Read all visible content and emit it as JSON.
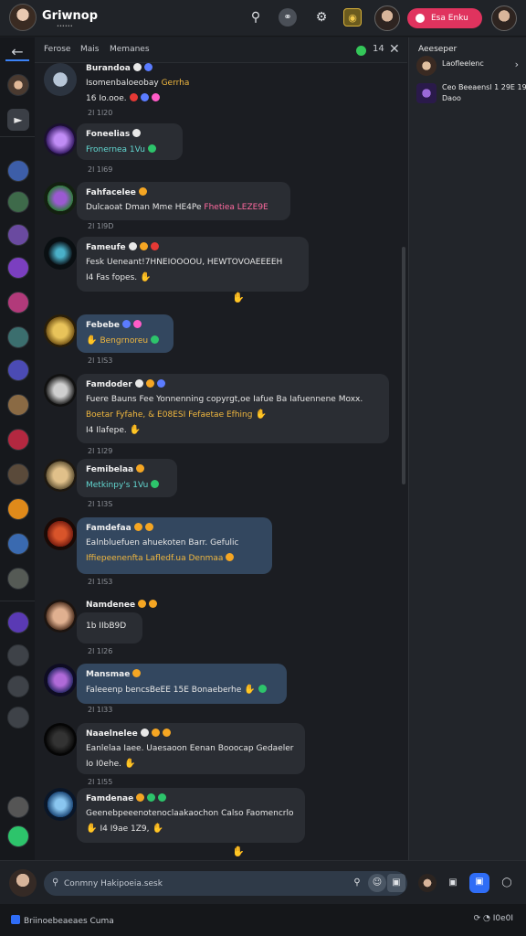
{
  "app": {
    "title": "Griwnop",
    "subtitle": "••••••",
    "pill_label": "Esa Enku"
  },
  "chat_header": {
    "tabs": [
      "Ferose",
      "Mais",
      "Memanes"
    ],
    "count": "14"
  },
  "messages": [
    {
      "name": "Burandoa",
      "lines": [
        {
          "text": "Isomenbaloeobay",
          "accent": "Gerrha"
        }
      ],
      "time": "16 Io.ooe.",
      "style": "plain"
    },
    {
      "name": "Foneelias",
      "lines": [
        {
          "text": "Fronernea 1Vu"
        }
      ],
      "time": "2l  1l69",
      "style": "plain",
      "teal": true
    },
    {
      "name": "Fahfacelee",
      "lines": [
        {
          "text": "Dulcaoat Dman Mme HE4Pe",
          "accent": "Fhetiea LEZE9E"
        }
      ],
      "time": "2l  1l9D",
      "style": "plain"
    },
    {
      "name": "Fameufe",
      "lines": [
        {
          "text": "Fesk Ueneant!7HNEIOOOOU, HEWTOVOAEEEEH"
        },
        {
          "text": "I4 Fas fopes."
        }
      ],
      "time": "",
      "style": "plain"
    },
    {
      "name": "Febebe",
      "lines": [
        {
          "text": "Bengrnoreu"
        }
      ],
      "time": "2l  1lS3",
      "style": "blue",
      "gold": true
    },
    {
      "name": "Famdoder",
      "lines": [
        {
          "text": "Fuere Bauns Fee Yonnenning copyrgt,oe Iafue Ba Iafuennene Moxx."
        },
        {
          "text": "Boetar Fyfahe, & E08ESI Fefaetae Efhing",
          "gold": true
        },
        {
          "text": "I4 Ilafepe."
        }
      ],
      "time": "2l  1l29",
      "style": "plain"
    },
    {
      "name": "Femibelaa",
      "lines": [
        {
          "text": "Metkinpy's 1Vu"
        }
      ],
      "time": "2l  1l3S",
      "style": "plain",
      "teal": true
    },
    {
      "name": "Famdefaa",
      "lines": [
        {
          "text": "Ealnbluefuen ahuekoten Barr. Gefulic"
        },
        {
          "text": "Iffiepeenenfta Lafledf.ua Denmaa",
          "gold": true
        }
      ],
      "time": "2l  1lS3",
      "style": "blue"
    },
    {
      "name": "Namdenee",
      "lines": [
        {
          "text": "1b IIbB9D"
        }
      ],
      "time": "2l  1l26",
      "style": "plain"
    },
    {
      "name": "Mansmae",
      "lines": [
        {
          "text": "Faleeenp bencsBeEE 15E Bonaeberhe"
        }
      ],
      "time": "2l  1l33",
      "style": "blue"
    },
    {
      "name": "Naaelnelee",
      "lines": [
        {
          "text": "Eanlelaa Iaee. Uaesaoon Eenan Booocap Gedaeler"
        },
        {
          "text": "Io I0ehe."
        }
      ],
      "time": "2l  1l55",
      "style": "plain"
    },
    {
      "name": "Famdenae",
      "lines": [
        {
          "text": "Geenebpeeenotenoclaakaochon Calso Faomencrlo"
        },
        {
          "text": "I4 I9ae  1Z9,"
        }
      ],
      "time": "",
      "style": "plain"
    }
  ],
  "right_panel": {
    "title": "Aeeseper",
    "rows": [
      {
        "text": "Laofleelenc"
      },
      {
        "text": "Ceo Beeaensl 1 29E 19",
        "text2": "Daoo"
      }
    ]
  },
  "composer": {
    "placeholder": "Conmny Hakipoeia.sesk"
  },
  "status_bar": {
    "left": "Briinoebeaeaes Cuma",
    "right": "I0e0I"
  },
  "colors": {
    "accent_blue": "#2f6df6",
    "accent_pink": "#e0335e",
    "online_green": "#34c759",
    "teal_text": "#62d6d0",
    "gold_text": "#f0b73f"
  }
}
